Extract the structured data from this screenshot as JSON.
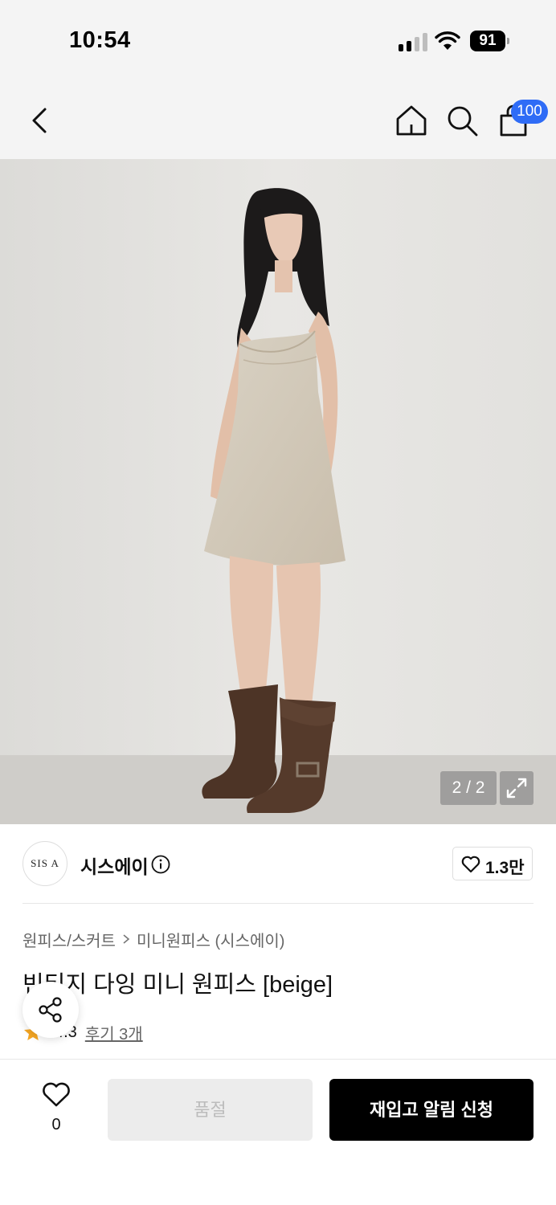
{
  "status_bar": {
    "time": "10:54",
    "battery": "91"
  },
  "header": {
    "cart_badge": "100"
  },
  "gallery": {
    "page_indicator": "2 / 2"
  },
  "brand": {
    "logo_text": "SIS A",
    "name": "시스에이",
    "like_count": "1.3만"
  },
  "breadcrumb": {
    "category": "원피스/스커트",
    "subcategory": "미니원피스 (시스에이)"
  },
  "product": {
    "title": "빈티지 다잉 미니 원피스 [beige]",
    "rating": "4.3",
    "reviews": "후기 3개"
  },
  "bottom": {
    "wish_count": "0",
    "soldout_label": "품절",
    "restock_label": "재입고 알림 신청"
  },
  "colors": {
    "accent": "#2f6cf6",
    "star": "#f5a623",
    "cta": "#000000"
  }
}
